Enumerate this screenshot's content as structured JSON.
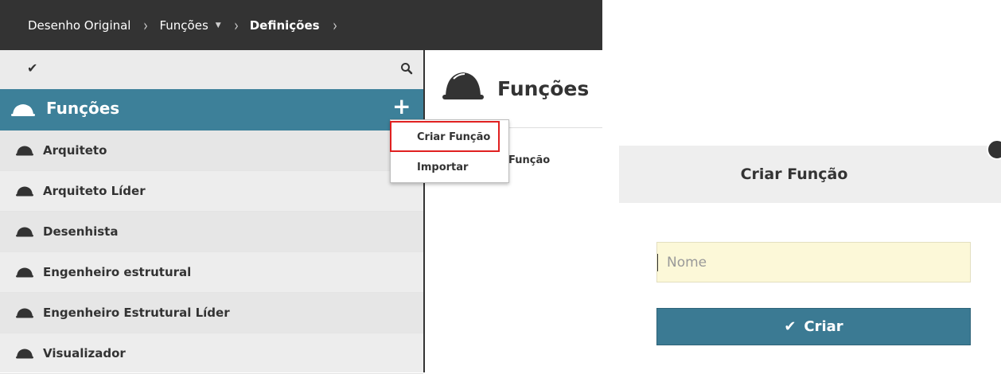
{
  "breadcrumb": {
    "items": [
      "Desenho Original",
      "Funções",
      "Definições"
    ],
    "separator": "›",
    "dropdown_caret": "▼"
  },
  "sidebar": {
    "toolbar": {
      "check_glyph": "✔",
      "search_icon": "search-icon"
    },
    "header": {
      "title": "Funções",
      "add_glyph": "+",
      "icon": "hard-hat-icon"
    },
    "items": [
      {
        "label": "Arquiteto"
      },
      {
        "label": "Arquiteto Líder"
      },
      {
        "label": "Desenhista"
      },
      {
        "label": "Engenheiro estrutural"
      },
      {
        "label": "Engenheiro Estrutural Líder"
      },
      {
        "label": "Visualizador"
      }
    ]
  },
  "main": {
    "title": "Funções",
    "column_label": "Função"
  },
  "dropdown": {
    "items": [
      {
        "label": "Criar Função",
        "highlighted": true
      },
      {
        "label": "Importar",
        "highlighted": false
      }
    ]
  },
  "dialog": {
    "title": "Criar Função",
    "input": {
      "value": "",
      "placeholder": "Nome"
    },
    "button": {
      "check_glyph": "✔",
      "label": "Criar"
    }
  },
  "colors": {
    "topbar": "#333333",
    "accent": "#3d8099",
    "button": "#3b7a93",
    "input_bg": "#fcf8d8",
    "highlight_border": "#e02020"
  }
}
